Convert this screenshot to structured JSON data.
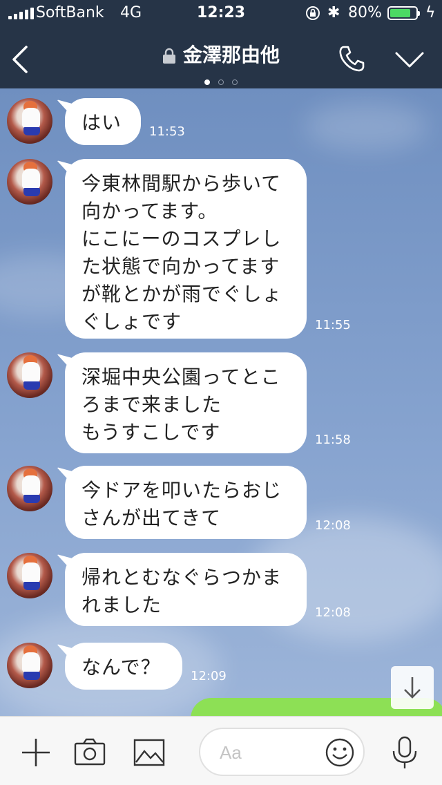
{
  "status": {
    "carrier": "SoftBank",
    "network": "4G",
    "time": "12:23",
    "battery_percent": "80%",
    "battery_level": 0.8,
    "battery_color": "#4cd964"
  },
  "header": {
    "title": "金澤那由他",
    "page_dots": 3,
    "active_dot": 0,
    "icons": [
      "back-arrow-icon",
      "padlock-icon",
      "phone-icon",
      "chevron-down-icon"
    ]
  },
  "messages": [
    {
      "text": "はい",
      "time": "11:53"
    },
    {
      "text": "今東林間駅から歩いて\n向かってます。\nにこにーのコスプレし\nた状態で向かってます\nが靴とかが雨でぐしょ\nぐしょです",
      "time": "11:55"
    },
    {
      "text": "深堀中央公園ってとこ\nろまで来ました\nもうすこしです",
      "time": "11:58"
    },
    {
      "text": "今ドアを叩いたらおじ\nさんが出てきて",
      "time": "12:08"
    },
    {
      "text": "帰れとむなぐらつかま\nれました",
      "time": "12:08"
    },
    {
      "text": "なんで？",
      "time": "12:09"
    }
  ],
  "composer": {
    "placeholder": "Aa",
    "icons": [
      "plus-icon",
      "camera-icon",
      "image-icon",
      "smiley-icon",
      "microphone-icon"
    ]
  },
  "colors": {
    "header_bg": "#263447",
    "chat_bg": "#7d9ccb",
    "own_bubble": "#8de055"
  }
}
